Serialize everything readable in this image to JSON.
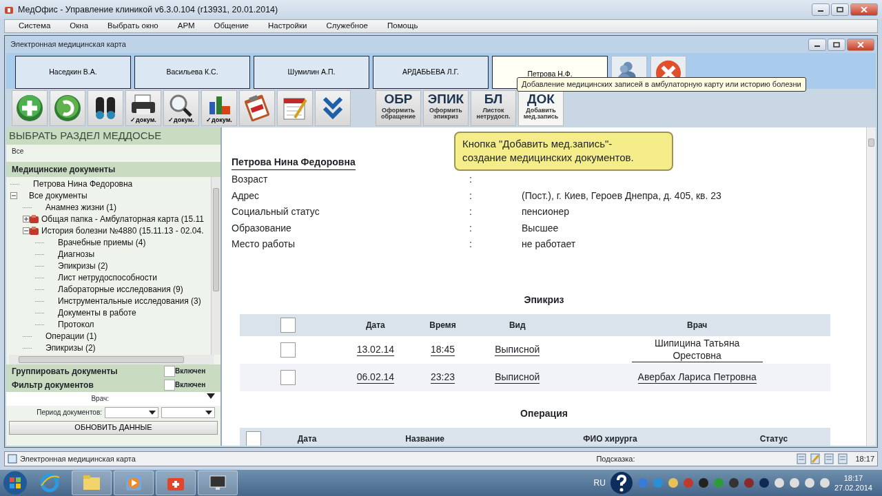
{
  "window": {
    "title": "МедОфис - Управление клиникой v6.3.0.104 (r13931, 20.01.2014)"
  },
  "menu": [
    "Система",
    "Окна",
    "Выбрать окно",
    "АРМ",
    "Общение",
    "Настройки",
    "Служебное",
    "Помощь"
  ],
  "child_window": {
    "title": "Электронная медицинская карта"
  },
  "patient_tabs": [
    {
      "label": "Наседкин В.А.",
      "selected": false
    },
    {
      "label": "Васильева К.С.",
      "selected": false
    },
    {
      "label": "Шумилин А.П.",
      "selected": false
    },
    {
      "label": "АРДАБЬЕВА Л.Г.",
      "selected": false
    },
    {
      "label": "Петрова Н.Ф.",
      "selected": true
    }
  ],
  "tab_actions": [
    {
      "kind": "people"
    },
    {
      "kind": "close"
    }
  ],
  "toolbar": [
    {
      "kind": "plus"
    },
    {
      "kind": "refresh"
    },
    {
      "kind": "binoculars"
    },
    {
      "kind": "printer",
      "caption": "✓докум."
    },
    {
      "kind": "magnifier",
      "caption": "✓докум."
    },
    {
      "kind": "chart",
      "caption": "✓докум."
    },
    {
      "kind": "clipboard"
    },
    {
      "kind": "calendar"
    },
    {
      "kind": "chevrons"
    }
  ],
  "code_buttons": [
    {
      "code": "ОБР",
      "caption": "Оформить обращение",
      "hovered": false
    },
    {
      "code": "ЭПИК",
      "caption": "Оформить эпикриз",
      "hovered": false
    },
    {
      "code": "БЛ",
      "caption": "Листок нетрудосп.",
      "hovered": false
    },
    {
      "code": "ДОК",
      "caption": "Добавить мед.запись",
      "hovered": true
    }
  ],
  "tooltip": "Добавление медицинских записей в амбулаторную карту или историю болезни",
  "sidebar": {
    "header": "ВЫБРАТЬ РАЗДЕЛ МЕДДОСЬЕ",
    "filter": "Все",
    "section": "Медицинские документы",
    "tree": [
      {
        "label": "Петрова Нина Федоровна"
      },
      {
        "label": "Все документы",
        "expanded": true,
        "children": [
          {
            "label": "Анамнез жизни (1)"
          },
          {
            "label": "Общая папка - Амбулаторная карта (15.11",
            "expanded": false,
            "folder": true
          },
          {
            "label": "История болезни №4880 (15.11.13 - 02.04.",
            "expanded": true,
            "folder": true,
            "children": [
              {
                "label": "Врачебные приемы (4)"
              },
              {
                "label": "Диагнозы"
              },
              {
                "label": "Эпикризы (2)"
              },
              {
                "label": "Лист нетрудоспособности"
              },
              {
                "label": "Лабораторные исследования (9)"
              },
              {
                "label": "Инструментальные исследования (3)"
              },
              {
                "label": "Документы в работе"
              },
              {
                "label": "Протокол"
              }
            ]
          },
          {
            "label": "Операции (1)"
          },
          {
            "label": "Эпикризы (2)"
          }
        ]
      }
    ],
    "options": [
      {
        "label": "Группировать документы",
        "checked": false,
        "state_label": "Включен"
      },
      {
        "label": "Фильтр документов",
        "checked": false,
        "state_label": "Включен"
      }
    ],
    "doctor_label": "Врач:",
    "period_label": "Период документов:",
    "refresh_button": "ОБНОВИТЬ ДАННЫЕ"
  },
  "patient": {
    "name": "Петрова Нина Федоровна",
    "fields": [
      {
        "label": "Возраст",
        "separator": ":"
      },
      {
        "label": "Адрес",
        "separator": ":",
        "value": "(Пост.), г. Киев, Героев Днепра, д. 405, кв. 23"
      },
      {
        "label": "Социальный статус",
        "separator": ":",
        "value": "пенсионер"
      },
      {
        "label": "Образование",
        "separator": ":",
        "value": "Высшее"
      },
      {
        "label": "Место работы",
        "separator": ":",
        "value": "не работает"
      }
    ]
  },
  "callout": [
    "Кнопка \"Добавить мед.запись\"-",
    "создание медицинских документов."
  ],
  "epicrisis": {
    "title": "Эпикриз",
    "select_all": false,
    "columns": [
      "Дата",
      "Время",
      "Вид",
      "Врач"
    ],
    "rows": [
      {
        "checked": false,
        "cells": [
          "13.02.14",
          "18:45",
          "Выписной",
          "Шипицина Татьяна Орестовна"
        ]
      },
      {
        "checked": false,
        "cells": [
          "06.02.14",
          "23:23",
          "Выписной",
          "Авербах Лариса Петровна"
        ]
      }
    ]
  },
  "operation": {
    "title": "Операция",
    "select_all": false,
    "columns": [
      "Дата",
      "Название",
      "ФИО хирурга",
      "Статус"
    ]
  },
  "status_bar": {
    "text": "Электронная медицинская карта",
    "hint_label": "Подсказка:",
    "time": "18:17"
  },
  "taskbar": {
    "language": "RU",
    "time": "18:17",
    "date": "27.02.2014"
  }
}
